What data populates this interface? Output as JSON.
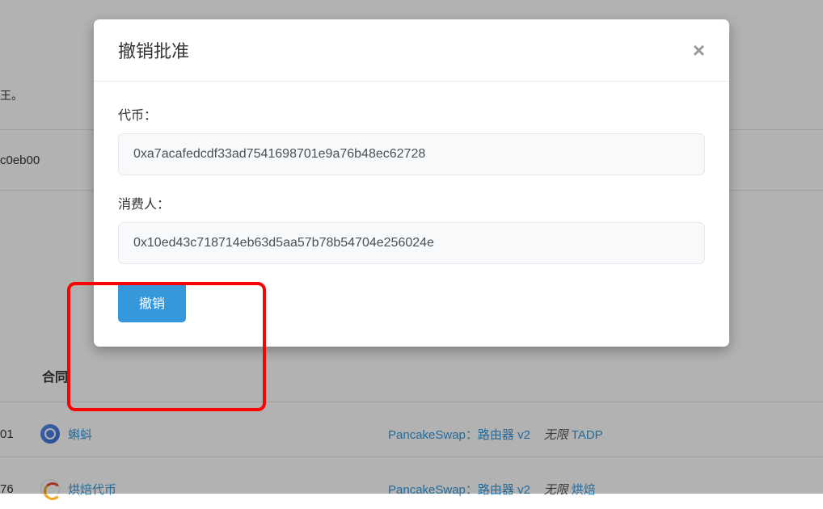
{
  "background": {
    "text_top_fragment": "王。",
    "hash_fragment": "c0eb00",
    "contract_label": "合同",
    "row1": {
      "num": "01",
      "name": "蝌蚪",
      "right_prefix": "PancakeSwap：路由器 v2",
      "right_italic": "无限",
      "right_suffix": "TADP"
    },
    "row2": {
      "num": "76",
      "name": "烘焙代币",
      "right_prefix": "PancakeSwap：路由器 v2",
      "right_italic": "无限",
      "right_suffix": "烘焙"
    }
  },
  "modal": {
    "title": "撤销批准",
    "close_symbol": "×",
    "token_label": "代币：",
    "token_value": "0xa7acafedcdf33ad7541698701e9a76b48ec62728",
    "spender_label": "消费人：",
    "spender_value": "0x10ed43c718714eb63d5aa57b78b54704e256024e",
    "revoke_button": "撤销"
  }
}
